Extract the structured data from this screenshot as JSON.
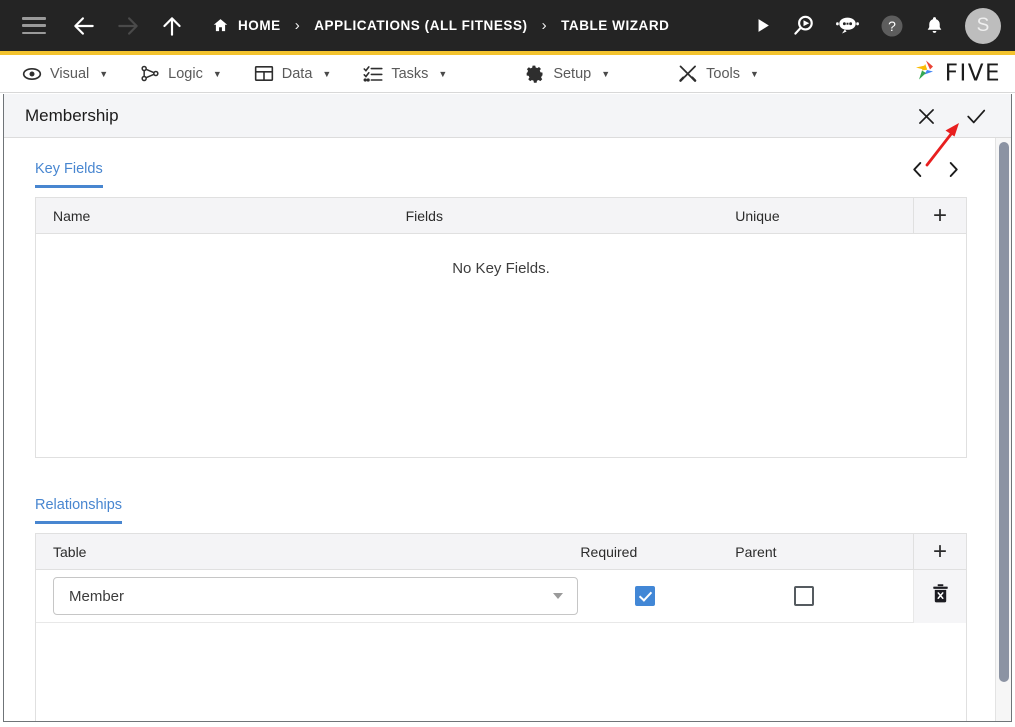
{
  "topbar": {
    "background": "#242424",
    "accent_color": "#f3c32e",
    "nav_icons": [
      {
        "name": "hamburger-menu-icon",
        "label": "Menu"
      },
      {
        "name": "arrow-back-icon",
        "label": "Back"
      },
      {
        "name": "arrow-forward-icon",
        "label": "Forward"
      },
      {
        "name": "arrow-up-icon",
        "label": "Up"
      }
    ],
    "breadcrumb": [
      {
        "label": "HOME",
        "icon": "home-icon"
      },
      {
        "label": "APPLICATIONS (ALL FITNESS)"
      },
      {
        "label": "TABLE WIZARD"
      }
    ],
    "breadcrumb_separator": "›",
    "right_icons": [
      {
        "name": "run-play-icon"
      },
      {
        "name": "search-run-icon"
      },
      {
        "name": "chat-bot-icon"
      },
      {
        "name": "help-icon"
      },
      {
        "name": "notifications-bell-icon"
      }
    ],
    "avatar_initial": "S"
  },
  "menubar": {
    "items": [
      {
        "label": "Visual",
        "icon": "eye-icon",
        "caret": "▼"
      },
      {
        "label": "Logic",
        "icon": "logic-nodes-icon",
        "caret": "▼"
      },
      {
        "label": "Data",
        "icon": "table-grid-icon",
        "caret": "▼"
      },
      {
        "label": "Tasks",
        "icon": "checklist-icon",
        "caret": "▼"
      },
      {
        "label": "Setup",
        "icon": "gear-icon",
        "caret": "▼"
      },
      {
        "label": "Tools",
        "icon": "tools-wrench-icon",
        "caret": "▼"
      }
    ],
    "logo_text": "FIVE"
  },
  "dialog": {
    "title": "Membership",
    "close_label": "✕",
    "confirm_label": "✓"
  },
  "key_fields": {
    "tab_label": "Key Fields",
    "prev_label": "‹",
    "next_label": "›",
    "add_label": "+",
    "columns": [
      "Name",
      "Fields",
      "Unique"
    ],
    "empty_message": "No Key Fields.",
    "rows": []
  },
  "relationships": {
    "tab_label": "Relationships",
    "add_label": "+",
    "columns": [
      "Table",
      "Required",
      "Parent"
    ],
    "rows": [
      {
        "table": "Member",
        "required": true,
        "parent": false,
        "delete_icon": "trash-delete-icon"
      }
    ]
  },
  "annotation": {
    "type": "red-arrow",
    "color": "#e81f1f",
    "points_to": "confirm-checkmark-button"
  }
}
